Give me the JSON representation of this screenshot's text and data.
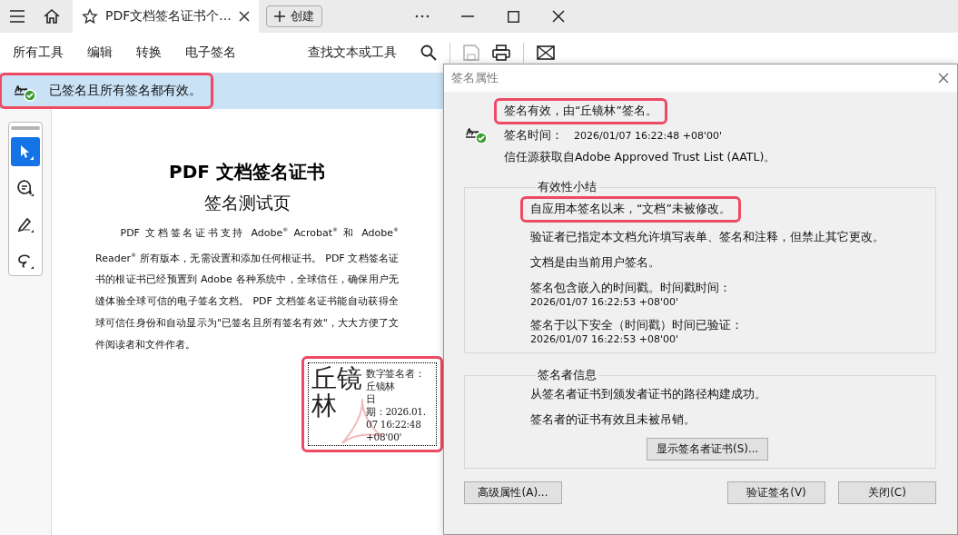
{
  "browser": {
    "tabs": [
      {
        "title": "PDF文档签名证书个...",
        "selected": true
      }
    ],
    "create_button": "创建"
  },
  "menu": {
    "items": [
      "所有工具",
      "编辑",
      "转换",
      "电子签名"
    ],
    "search": "查找文本或工具"
  },
  "status_bar": {
    "text": "已签名且所有签名都有效。",
    "highlighted": true
  },
  "tools": [
    {
      "kind": "select",
      "selected": true
    },
    {
      "kind": "comment",
      "selected": false
    },
    {
      "kind": "draw",
      "selected": false
    },
    {
      "kind": "lasso",
      "selected": false
    }
  ],
  "document": {
    "title": "PDF 文档签名证书",
    "subtitle": "签名测试页",
    "paragraph": "PDF 文档签名证书支持 Adobe$^{®}$ Acrobat$^{®}$ 和 Adobe$^{®}$ Reader$^{®}$ 所有版本，无需设置和添加任何根证书。 PDF 文档签名证书的根证书已经预置到 Adobe 各种系统中，全球信任，确保用户无缝体验全球可信的电子签名文档。 PDF 文档签名证书能自动获得全球可信任身份和自动显示为\"已签名且所有签名有效\"，大大方便了文件阅读者和文件作者。",
    "stamp": {
      "name": "丘镜林",
      "details": [
        "数字签名者：",
        "丘镜林",
        "日",
        "期：2026.01.",
        "07 16:22:48",
        "+08'00'"
      ],
      "highlighted": true
    }
  },
  "dialog": {
    "title": "签名属性",
    "headline": {
      "text": "签名有效，由“丘镜林”签名。",
      "highlighted": true
    },
    "time_label": "签名时间：",
    "time_value": "2026/01/07 16:22:48 +08'00'",
    "trust": "信任源获取自Adobe Approved Trust List (AATL)。",
    "groups": [
      {
        "title": "有效性小结",
        "items": [
          {
            "text": "自应用本签名以来，“文档”未被修改。",
            "highlighted": true
          },
          {
            "text": "验证者已指定本文档允许填写表单、签名和注释，但禁止其它更改。",
            "highlighted": false
          },
          {
            "text": "文档是由当前用户签名。",
            "highlighted": false
          },
          {
            "text": "签名包含嵌入的时间戳。时间戳时间：",
            "detail": "2026/01/07 16:22:53 +08'00'",
            "highlighted": false
          },
          {
            "text": "签名于以下安全（时间戳）时间已验证：",
            "detail": "2026/01/07 16:22:53 +08'00'",
            "highlighted": false
          }
        ]
      },
      {
        "title": "签名者信息",
        "items": [
          {
            "text": "从签名者证书到颁发者证书的路径构建成功。",
            "highlighted": false
          },
          {
            "text": "签名者的证书有效且未被吊销。",
            "highlighted": false
          }
        ],
        "button": "显示签名者证书(S)..."
      }
    ],
    "buttons": [
      "高级属性(A)...",
      "验证签名(V)",
      "关闭(C)"
    ]
  }
}
